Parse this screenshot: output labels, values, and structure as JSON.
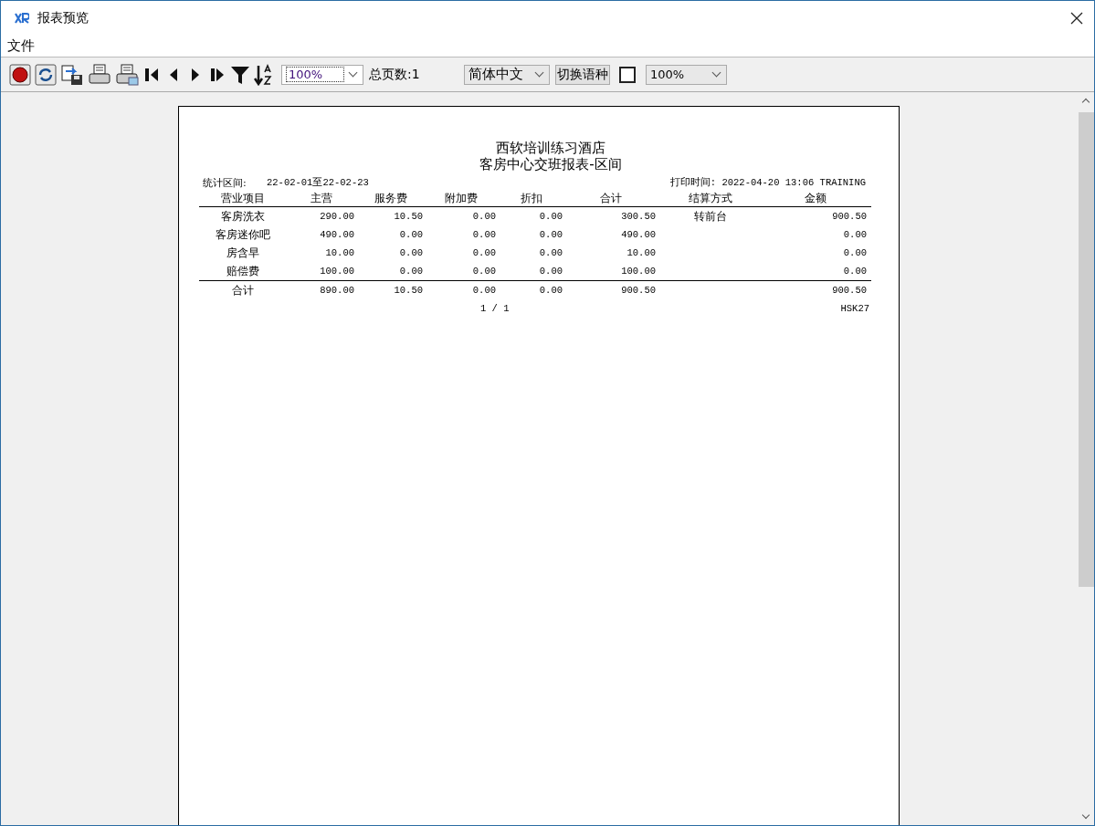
{
  "window": {
    "title": "报表预览"
  },
  "menu": [
    "文件"
  ],
  "toolbar": {
    "zoom": "100%",
    "page_count": "总页数:1",
    "language": "简体中文",
    "switch_language": "切换语种",
    "toggle": {
      "checked": false
    },
    "zoom2": "100%"
  },
  "report": {
    "title": "西软培训练习酒店",
    "subtitle": "客房中心交班报表-区间",
    "period_label": "统计区间:",
    "period": "22-02-01至22-02-23",
    "print_time": "打印时间: 2022-04-20 13:06 TRAINING",
    "columns": [
      "营业项目",
      "主营",
      "服务费",
      "附加费",
      "折扣",
      "合计",
      "结算方式",
      "金额"
    ],
    "rows": [
      {
        "item": "客房洗衣",
        "main": "290.00",
        "service": "10.50",
        "extra": "0.00",
        "discount": "0.00",
        "sum": "300.50",
        "settlement": "转前台",
        "amount": "900.50"
      },
      {
        "item": "客房迷你吧",
        "main": "490.00",
        "service": "0.00",
        "extra": "0.00",
        "discount": "0.00",
        "sum": "490.00",
        "amount": "0.00"
      },
      {
        "item": "房含早",
        "main": "10.00",
        "service": "0.00",
        "extra": "0.00",
        "discount": "0.00",
        "sum": "10.00",
        "amount": "0.00"
      },
      {
        "item": "赔偿费",
        "main": "100.00",
        "service": "0.00",
        "extra": "0.00",
        "discount": "0.00",
        "sum": "100.00",
        "amount": "0.00"
      }
    ],
    "total": {
      "item": "合计",
      "main": "890.00",
      "service": "10.50",
      "extra": "0.00",
      "discount": "0.00",
      "sum": "900.50",
      "amount": "900.50"
    },
    "page": "1 / 1",
    "code": "HSK27"
  }
}
